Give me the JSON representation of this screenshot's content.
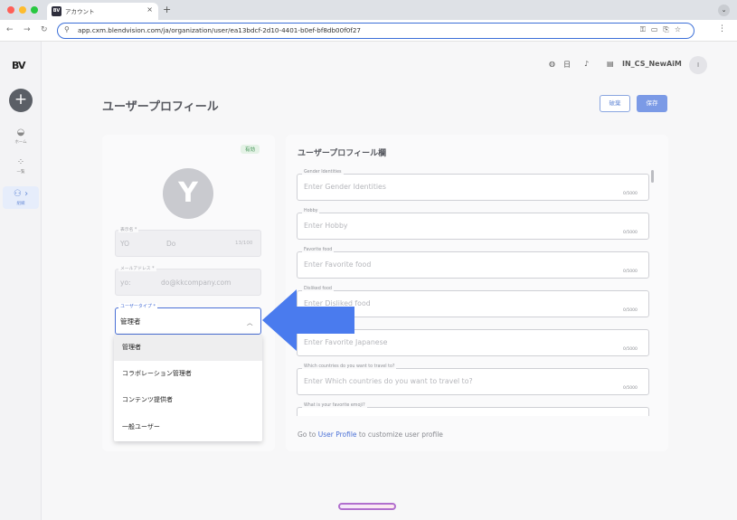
{
  "browser": {
    "tab_title": "アカウント",
    "tab_favicon": "BV",
    "tab_close": "×",
    "new_tab": "+",
    "url": "app.cxm.blendvision.com/ja/organization/user/ea13bdcf-2d10-4401-b0ef-bf8db00f0f27"
  },
  "sidebar": {
    "logo": "BV",
    "items": [
      {
        "label": "ホーム",
        "icon": "home-icon"
      },
      {
        "label": "一覧",
        "icon": "grid-icon"
      },
      {
        "label": "組織",
        "icon": "users-icon"
      }
    ]
  },
  "topbar": {
    "language": "日",
    "workspace": "IN_CS_NewAiM",
    "avatar_initial": "I"
  },
  "page": {
    "title": "ユーザープロフィール",
    "discard_label": "破棄",
    "save_label": "保存"
  },
  "profile": {
    "status_badge": "有効",
    "avatar_initial": "Y",
    "display_name": {
      "label": "表示名 *",
      "first": "YO",
      "last": "Do",
      "count": "13/100"
    },
    "email": {
      "label": "メールアドレス *",
      "prefix": "yo:",
      "domain": "do@kkcompany.com"
    },
    "user_type": {
      "label": "ユーザータイプ *",
      "value": "管理者",
      "options": [
        "管理者",
        "コラボレーション管理者",
        "コンテンツ提供者",
        "一般ユーザー"
      ]
    }
  },
  "custom_fields": {
    "title": "ユーザープロフィール欄",
    "fields": [
      {
        "label": "Gender Identities",
        "placeholder": "Enter Gender Identities",
        "count": "0/5000"
      },
      {
        "label": "Hobby",
        "placeholder": "Enter Hobby",
        "count": "0/5000"
      },
      {
        "label": "Favorite food",
        "placeholder": "Enter Favorite food",
        "count": "0/5000"
      },
      {
        "label": "Disliked food",
        "placeholder": "Enter Disliked food",
        "count": "0/5000"
      },
      {
        "label": "",
        "placeholder": "Enter Favorite Japanese",
        "count": "0/5000"
      },
      {
        "label": "Which countries do you want to travel to?",
        "placeholder": "Enter Which countries do you want to travel to?",
        "count": "0/5000"
      },
      {
        "label": "What is your favorite emoji?",
        "placeholder": "",
        "count": ""
      }
    ],
    "footer_prefix": "Go to",
    "footer_link": "User Profile",
    "footer_suffix": "to customize user profile"
  },
  "colors": {
    "accent": "#4a70d6",
    "save_button": "#7b9ae6",
    "badge_bg": "#e4f2e6",
    "badge_text": "#3f9152",
    "arrow": "#4a7bee"
  }
}
